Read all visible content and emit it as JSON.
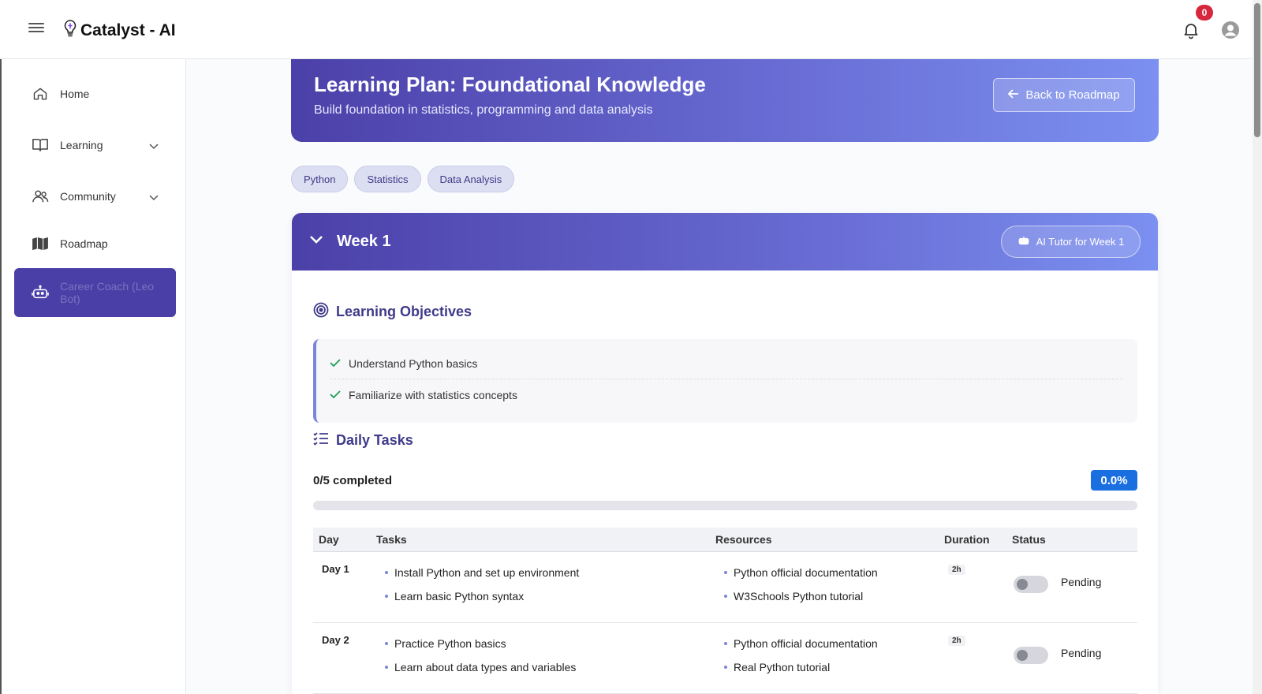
{
  "app": {
    "brand": "Catalyst - AI",
    "notifications": "0"
  },
  "sidebar": {
    "items": [
      {
        "label": "Home",
        "icon": "home-icon"
      },
      {
        "label": "Learning",
        "icon": "book-icon"
      },
      {
        "label": "Community",
        "icon": "users-icon"
      },
      {
        "label": "Roadmap",
        "icon": "map-icon"
      },
      {
        "label": "Career Coach (Leo Bot)",
        "icon": "robot-icon",
        "active": true
      }
    ]
  },
  "header": {
    "title": "Learning Plan: Foundational Knowledge",
    "subtitle": "Build foundation in statistics, programming and data analysis",
    "back_label": "Back to Roadmap"
  },
  "tags": [
    "Python",
    "Statistics",
    "Data Analysis"
  ],
  "week": {
    "title": "Week 1",
    "tutor_label": "AI Tutor for Week 1",
    "objectives_title": "Learning Objectives",
    "objectives": [
      "Understand Python basics",
      "Familiarize with statistics concepts"
    ],
    "tasks_title": "Daily Tasks",
    "progress_text": "0/5 completed",
    "progress_pct": "0.0%",
    "progress_value": 0.0,
    "columns": [
      "Day",
      "Tasks",
      "Resources",
      "Duration",
      "Status"
    ],
    "rows": [
      {
        "day": "Day 1",
        "tasks": [
          "Install Python and set up environment",
          "Learn basic Python syntax"
        ],
        "resources": [
          "Python official documentation",
          "W3Schools Python tutorial"
        ],
        "duration": "2h",
        "status": "Pending"
      },
      {
        "day": "Day 2",
        "tasks": [
          "Practice Python basics",
          "Learn about data types and variables"
        ],
        "resources": [
          "Python official documentation",
          "Real Python tutorial"
        ],
        "duration": "2h",
        "status": "Pending"
      }
    ]
  },
  "colors": {
    "primary": "#4b40a8",
    "accent": "#1a6fe0",
    "badge": "#d7263d"
  }
}
